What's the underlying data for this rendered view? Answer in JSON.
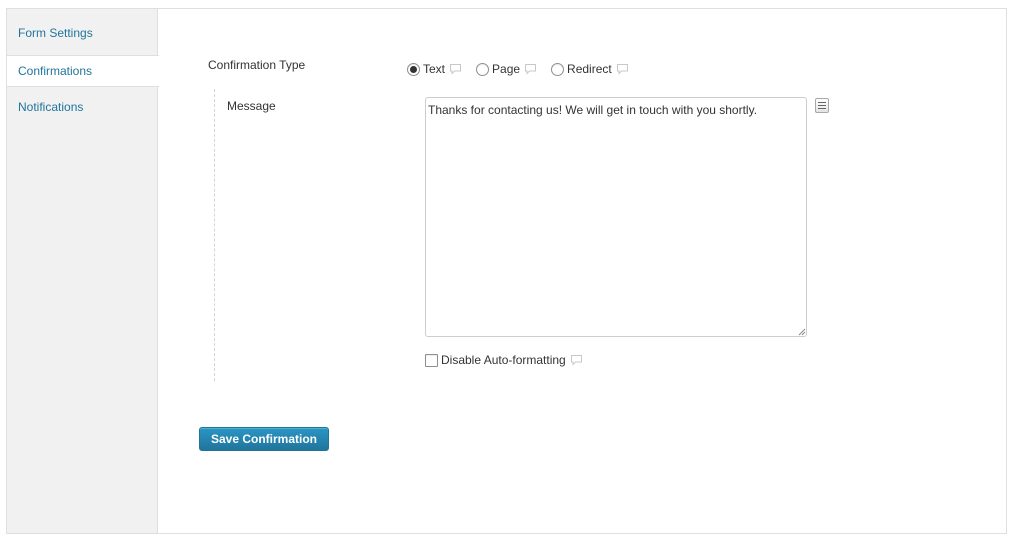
{
  "sidebar": {
    "items": [
      {
        "label": "Form Settings",
        "active": false
      },
      {
        "label": "Confirmations",
        "active": true
      },
      {
        "label": "Notifications",
        "active": false
      }
    ]
  },
  "confirmation": {
    "type_label": "Confirmation Type",
    "options": [
      {
        "label": "Text",
        "selected": true
      },
      {
        "label": "Page",
        "selected": false
      },
      {
        "label": "Redirect",
        "selected": false
      }
    ],
    "message_label": "Message",
    "message_value": "Thanks for contacting us! We will get in touch with you shortly.",
    "disable_autoformat_label": "Disable Auto-formatting",
    "disable_autoformat_checked": false
  },
  "actions": {
    "save_label": "Save Confirmation"
  },
  "colors": {
    "link": "#21759b",
    "button": "#21759b",
    "sidebar_bg": "#f1f1f1"
  },
  "icons": {
    "tooltip": "speech-bubble-icon",
    "merge_tags": "merge-tag-list-icon"
  }
}
